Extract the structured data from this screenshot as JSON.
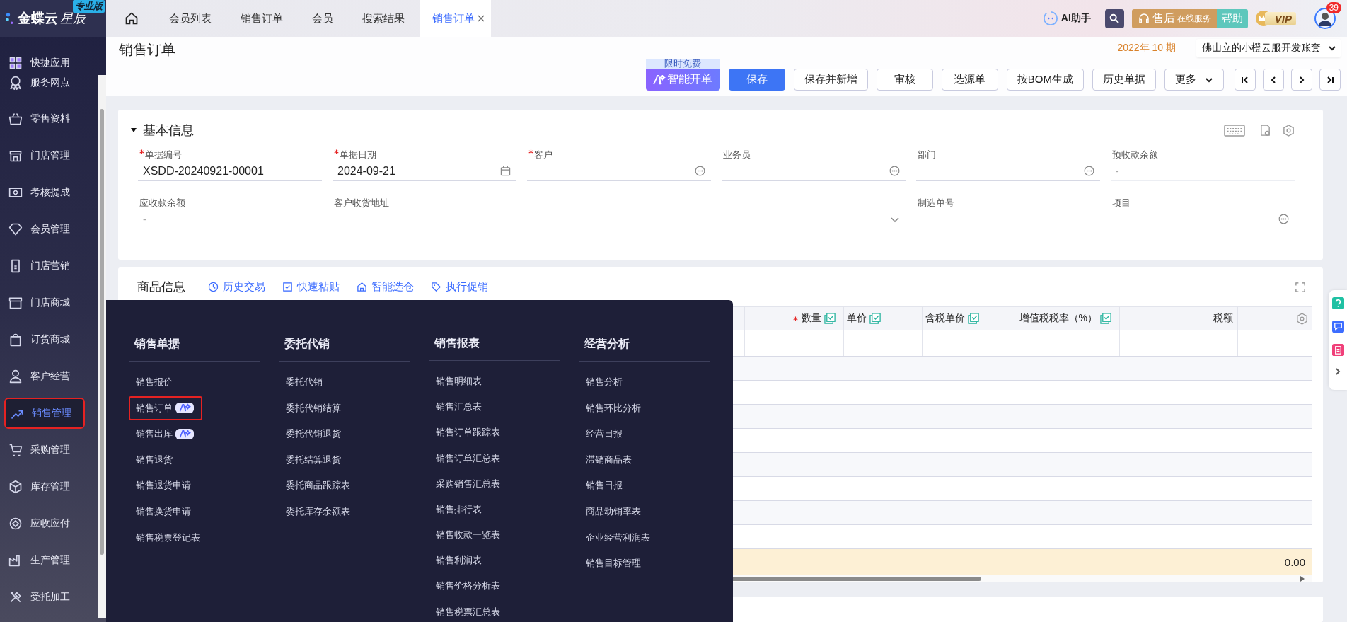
{
  "brand": {
    "name": "金蝶云",
    "sub": "星辰",
    "edition": "专业版"
  },
  "sidebar": {
    "items": [
      {
        "label": "快捷应用",
        "selected": false
      },
      {
        "label": "服务网点",
        "selected": false
      },
      {
        "label": "零售资料",
        "selected": false
      },
      {
        "label": "门店管理",
        "selected": false
      },
      {
        "label": "考核提成",
        "selected": false
      },
      {
        "label": "会员管理",
        "selected": false
      },
      {
        "label": "门店营销",
        "selected": false
      },
      {
        "label": "门店商城",
        "selected": false
      },
      {
        "label": "订货商城",
        "selected": false
      },
      {
        "label": "客户经营",
        "selected": false
      },
      {
        "label": "销售管理",
        "selected": true
      },
      {
        "label": "采购管理",
        "selected": false
      },
      {
        "label": "库存管理",
        "selected": false
      },
      {
        "label": "应收应付",
        "selected": false
      },
      {
        "label": "生产管理",
        "selected": false
      },
      {
        "label": "受托加工",
        "selected": false
      }
    ]
  },
  "tabs": [
    {
      "label": "会员列表",
      "selected": false,
      "closable": false
    },
    {
      "label": "销售订单",
      "selected": false,
      "closable": false
    },
    {
      "label": "会员",
      "selected": false,
      "closable": false
    },
    {
      "label": "搜索结果",
      "selected": false,
      "closable": false
    },
    {
      "label": "销售订单",
      "selected": true,
      "closable": true
    }
  ],
  "top_right": {
    "ai_assistant": "AI助手",
    "service": {
      "main": "售后",
      "sub": "在线服务"
    },
    "help": "帮助",
    "vip": "VIP",
    "notifications": "39"
  },
  "page_title": "销售订单",
  "period": "2022年 10 期",
  "account": "佛山立的小橙云服开发账套",
  "toolbar": {
    "promo_tag": "限时免费",
    "smart_button": "智能开单",
    "buttons": [
      {
        "label": "保存",
        "primary": true
      },
      {
        "label": "保存并新增",
        "primary": false
      },
      {
        "label": "审核",
        "primary": false
      },
      {
        "label": "选源单",
        "primary": false
      },
      {
        "label": "按BOM生成",
        "primary": false
      },
      {
        "label": "历史单据",
        "primary": false
      }
    ],
    "more": "更多"
  },
  "basic_info": {
    "title": "基本信息",
    "expanded": true,
    "fields": [
      {
        "label": "单据编号",
        "required": true,
        "value": "XSDD-20240921-00001",
        "kind": "text"
      },
      {
        "label": "单据日期",
        "required": true,
        "value": "2024-09-21",
        "kind": "date"
      },
      {
        "label": "客户",
        "required": true,
        "kind": "lookup"
      },
      {
        "label": "业务员",
        "required": false,
        "kind": "lookup"
      },
      {
        "label": "部门",
        "required": false,
        "kind": "lookup"
      },
      {
        "label": "预收款余额",
        "required": false,
        "value": "-",
        "kind": "readonly"
      },
      {
        "label": "应收款余额",
        "required": false,
        "value": "-",
        "kind": "readonly"
      },
      {
        "label": "客户收货地址",
        "required": false,
        "kind": "select"
      },
      {
        "label": "制造单号",
        "required": false,
        "kind": "text"
      },
      {
        "label": "项目",
        "required": false,
        "kind": "lookup"
      }
    ]
  },
  "goods": {
    "title": "商品信息",
    "actions": [
      "历史交易",
      "快速粘贴",
      "智能选仓",
      "执行促销"
    ],
    "table": {
      "columns": [
        {
          "label": "数量",
          "required": true,
          "batch": true
        },
        {
          "label": "单价",
          "required": false,
          "batch": true
        },
        {
          "label": "含税单价",
          "required": false,
          "batch": true
        },
        {
          "label": "增值税税率（%）",
          "required": false,
          "batch": true
        },
        {
          "label": "税额",
          "required": false,
          "batch": false
        }
      ],
      "total": "0.00"
    }
  },
  "menu": {
    "columns": [
      {
        "title": "销售单据",
        "items": [
          {
            "label": "销售报价",
            "selected": false,
            "ai": false
          },
          {
            "label": "销售订单",
            "selected": true,
            "ai": true
          },
          {
            "label": "销售出库",
            "selected": false,
            "ai": true
          },
          {
            "label": "销售退货",
            "selected": false,
            "ai": false
          },
          {
            "label": "销售退货申请",
            "selected": false,
            "ai": false
          },
          {
            "label": "销售换货申请",
            "selected": false,
            "ai": false
          },
          {
            "label": "销售税票登记表",
            "selected": false,
            "ai": false
          }
        ]
      },
      {
        "title": "委托代销",
        "items": [
          {
            "label": "委托代销",
            "selected": false,
            "ai": false
          },
          {
            "label": "委托代销结算",
            "selected": false,
            "ai": false
          },
          {
            "label": "委托代销退货",
            "selected": false,
            "ai": false
          },
          {
            "label": "委托结算退货",
            "selected": false,
            "ai": false
          },
          {
            "label": "委托商品跟踪表",
            "selected": false,
            "ai": false
          },
          {
            "label": "委托库存余额表",
            "selected": false,
            "ai": false
          }
        ]
      },
      {
        "title": "销售报表",
        "items": [
          {
            "label": "销售明细表",
            "selected": false,
            "ai": false
          },
          {
            "label": "销售汇总表",
            "selected": false,
            "ai": false
          },
          {
            "label": "销售订单跟踪表",
            "selected": false,
            "ai": false
          },
          {
            "label": "销售订单汇总表",
            "selected": false,
            "ai": false
          },
          {
            "label": "采购销售汇总表",
            "selected": false,
            "ai": false
          },
          {
            "label": "销售排行表",
            "selected": false,
            "ai": false
          },
          {
            "label": "销售收款一览表",
            "selected": false,
            "ai": false
          },
          {
            "label": "销售利润表",
            "selected": false,
            "ai": false
          },
          {
            "label": "销售价格分析表",
            "selected": false,
            "ai": false
          },
          {
            "label": "销售税票汇总表",
            "selected": false,
            "ai": false
          }
        ]
      },
      {
        "title": "经营分析",
        "items": [
          {
            "label": "销售分析",
            "selected": false,
            "ai": false
          },
          {
            "label": "销售环比分析",
            "selected": false,
            "ai": false
          },
          {
            "label": "经营日报",
            "selected": false,
            "ai": false
          },
          {
            "label": "滞销商品表",
            "selected": false,
            "ai": false
          },
          {
            "label": "销售日报",
            "selected": false,
            "ai": false
          },
          {
            "label": "商品动销率表",
            "selected": false,
            "ai": false
          },
          {
            "label": "企业经营利润表",
            "selected": false,
            "ai": false
          },
          {
            "label": "销售目标管理",
            "selected": false,
            "ai": false
          }
        ]
      }
    ]
  }
}
